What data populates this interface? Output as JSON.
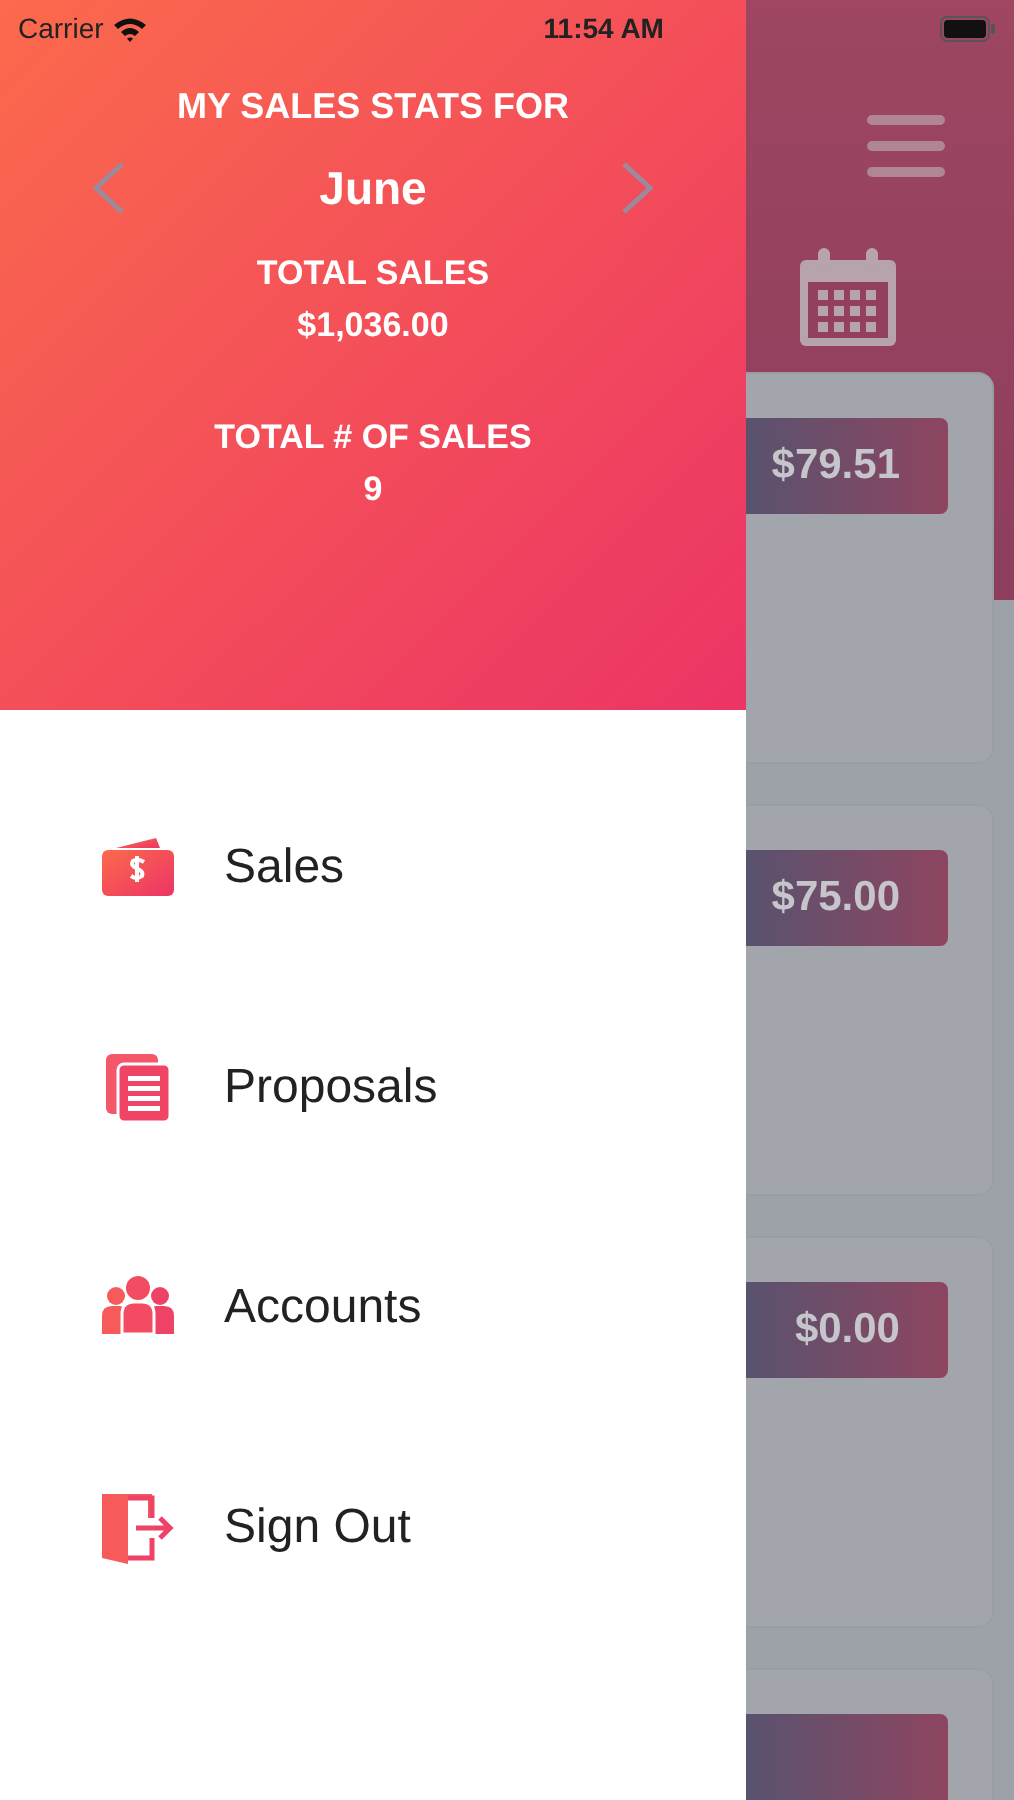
{
  "status_bar": {
    "carrier": "Carrier",
    "time": "11:54 AM"
  },
  "drawer": {
    "heading": "MY SALES STATS FOR",
    "month": "June",
    "stats": [
      {
        "label": "TOTAL SALES",
        "value": "$1,036.00"
      },
      {
        "label": "TOTAL # OF SALES",
        "value": "9"
      }
    ],
    "menu": [
      {
        "kind": "sales",
        "label": "Sales"
      },
      {
        "kind": "proposals",
        "label": "Proposals"
      },
      {
        "kind": "accounts",
        "label": "Accounts"
      },
      {
        "kind": "signout",
        "label": "Sign Out"
      }
    ]
  },
  "background_list": {
    "amounts": [
      "$79.51",
      "$75.00",
      "$0.00"
    ]
  }
}
